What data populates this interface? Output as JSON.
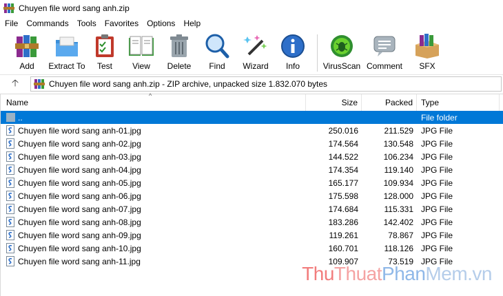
{
  "window": {
    "title": "Chuyen file word sang anh.zip"
  },
  "menu": [
    "File",
    "Commands",
    "Tools",
    "Favorites",
    "Options",
    "Help"
  ],
  "toolbar": [
    {
      "label": "Add",
      "icon": "add-icon"
    },
    {
      "label": "Extract To",
      "icon": "extract-to-icon"
    },
    {
      "label": "Test",
      "icon": "test-icon"
    },
    {
      "label": "View",
      "icon": "view-icon"
    },
    {
      "label": "Delete",
      "icon": "delete-icon"
    },
    {
      "label": "Find",
      "icon": "find-icon"
    },
    {
      "label": "Wizard",
      "icon": "wizard-icon"
    },
    {
      "label": "Info",
      "icon": "info-icon"
    },
    {
      "label": "VirusScan",
      "icon": "virusscan-icon"
    },
    {
      "label": "Comment",
      "icon": "comment-icon"
    },
    {
      "label": "SFX",
      "icon": "sfx-icon"
    }
  ],
  "address": {
    "text": "Chuyen file word sang anh.zip - ZIP archive, unpacked size 1.832.070 bytes"
  },
  "columns": {
    "name": "Name",
    "size": "Size",
    "packed": "Packed",
    "type": "Type"
  },
  "rows": [
    {
      "name": "..",
      "size": "",
      "packed": "",
      "type": "File folder",
      "selected": true,
      "kind": "up"
    },
    {
      "name": "Chuyen file word sang anh-01.jpg",
      "size": "250.016",
      "packed": "211.529",
      "type": "JPG File"
    },
    {
      "name": "Chuyen file word sang anh-02.jpg",
      "size": "174.564",
      "packed": "130.548",
      "type": "JPG File"
    },
    {
      "name": "Chuyen file word sang anh-03.jpg",
      "size": "144.522",
      "packed": "106.234",
      "type": "JPG File"
    },
    {
      "name": "Chuyen file word sang anh-04.jpg",
      "size": "174.354",
      "packed": "119.140",
      "type": "JPG File"
    },
    {
      "name": "Chuyen file word sang anh-05.jpg",
      "size": "165.177",
      "packed": "109.934",
      "type": "JPG File"
    },
    {
      "name": "Chuyen file word sang anh-06.jpg",
      "size": "175.598",
      "packed": "128.000",
      "type": "JPG File"
    },
    {
      "name": "Chuyen file word sang anh-07.jpg",
      "size": "174.684",
      "packed": "115.331",
      "type": "JPG File"
    },
    {
      "name": "Chuyen file word sang anh-08.jpg",
      "size": "183.286",
      "packed": "142.402",
      "type": "JPG File"
    },
    {
      "name": "Chuyen file word sang anh-09.jpg",
      "size": "119.261",
      "packed": "78.867",
      "type": "JPG File"
    },
    {
      "name": "Chuyen file word sang anh-10.jpg",
      "size": "160.701",
      "packed": "118.126",
      "type": "JPG File"
    },
    {
      "name": "Chuyen file word sang anh-11.jpg",
      "size": "109.907",
      "packed": "73.519",
      "type": "JPG File"
    }
  ],
  "watermark": {
    "a": "Thu",
    "b": "Thuat",
    "c": "Phan",
    "d": "Mem.vn"
  },
  "colors": {
    "selection": "#0078d7",
    "folder_up": "#9ab2c5"
  }
}
